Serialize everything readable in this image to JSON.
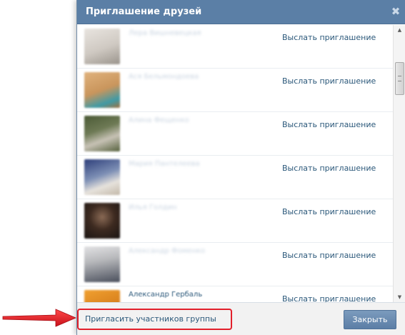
{
  "dialog": {
    "title": "Приглашение друзей",
    "close_glyph": "✖"
  },
  "friends": [
    {
      "name": "Лера Вишневецкая",
      "invite_label": "Выслать приглашение",
      "avatar_color": "#cfc9c2"
    },
    {
      "name": "Ася Бельмондоева",
      "invite_label": "Выслать приглашение",
      "avatar_color": "#c9955c"
    },
    {
      "name": "Алина Фещенко",
      "invite_label": "Выслать приглашение",
      "avatar_color": "#6e7a55"
    },
    {
      "name": "Мария Пантелеева",
      "invite_label": "Выслать приглашение",
      "avatar_color": "#7d8fb5"
    },
    {
      "name": "Илья Голдин",
      "invite_label": "Выслать приглашение",
      "avatar_color": "#3d2a20"
    },
    {
      "name": "Александр Фоменко",
      "invite_label": "Выслать приглашение",
      "avatar_color": "#b7b8bb"
    },
    {
      "name": "Александр Гербаль",
      "invite_label": "Выслать приглашение",
      "avatar_color": "#d9821e"
    }
  ],
  "footer": {
    "group_invite_label": "Пригласить участников группы",
    "close_button_label": "Закрыть"
  },
  "colors": {
    "accent": "#5b7fa6",
    "link": "#2b587a",
    "highlight": "#e2202b"
  }
}
